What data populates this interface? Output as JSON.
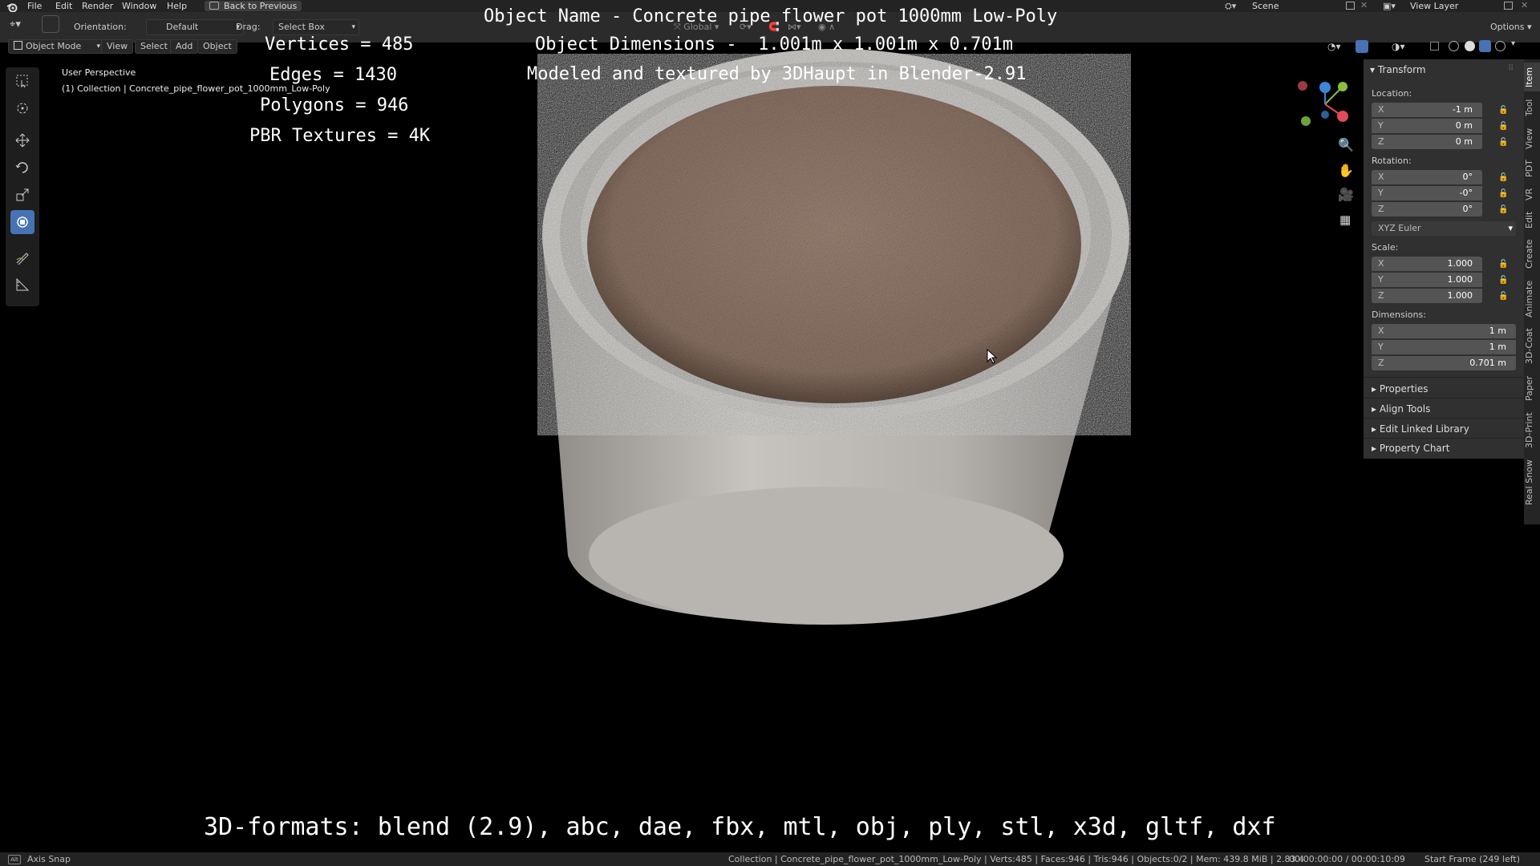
{
  "menubar": {
    "items": [
      "File",
      "Edit",
      "Render",
      "Window",
      "Help"
    ],
    "back_button": "Back to Previous",
    "scene_label": "Scene",
    "view_layer_label": "View Layer"
  },
  "toolheader": {
    "orientation_label": "Orientation:",
    "orientation_value": "Default",
    "drag_label": "Drag:",
    "drag_value": "Select Box",
    "transform_orientation": "Global",
    "options_label": "Options"
  },
  "viewport_header": {
    "mode": "Object Mode",
    "menus": [
      "View",
      "Select",
      "Add",
      "Object"
    ]
  },
  "viewport": {
    "perspective_label": "User Perspective",
    "collection_label": "(1) Collection | Concrete_pipe_flower_pot_1000mm_Low-Poly"
  },
  "overlay": {
    "vertices": "Vertices = 485",
    "edges": "Edges = 1430",
    "polygons": "Polygons = 946",
    "textures": "PBR Textures = 4K",
    "object_name": "Object Name - Concrete pipe flower pot 1000mm Low-Poly",
    "object_dimensions": "Object Dimensions -  1.001m x 1.001m x 0.701m",
    "credit": "Modeled and textured by 3DHaupt in Blender-2.91",
    "formats": "3D-formats: blend (2.9), abc, dae, fbx, mtl, obj, ply, stl, x3d, gltf, dxf"
  },
  "npanel": {
    "section_title": "Transform",
    "location_label": "Location:",
    "location": {
      "x": "-1 m",
      "y": "0 m",
      "z": "0 m"
    },
    "rotation_label": "Rotation:",
    "rotation": {
      "x": "0°",
      "y": "-0°",
      "z": "0°"
    },
    "rotation_mode": "XYZ Euler",
    "scale_label": "Scale:",
    "scale": {
      "x": "1.000",
      "y": "1.000",
      "z": "1.000"
    },
    "dimensions_label": "Dimensions:",
    "dimensions": {
      "x": "1 m",
      "y": "1 m",
      "z": "0.701 m"
    },
    "axis": {
      "x": "X",
      "y": "Y",
      "z": "Z"
    },
    "subpanels": [
      "Properties",
      "Align Tools",
      "Edit Linked Library",
      "Property Chart"
    ]
  },
  "sidebar_tabs": [
    "Item",
    "Tool",
    "View",
    "PDT",
    "VR",
    "Edit",
    "Create",
    "Animate",
    "3D-Coat",
    "Paper",
    "3D-Print",
    "Real Snow"
  ],
  "statusbar": {
    "left": "Axis Snap",
    "info": "Collection | Concrete_pipe_flower_pot_1000mm_Low-Poly | Verts:485 | Faces:946 | Tris:946 | Objects:0/2 | Mem: 439.8 MiB | 2.83.4",
    "timecode": "00:00:00:00 / 00:00:10:09",
    "frame": "Start Frame (249 left)"
  },
  "colors": {
    "accent": "#4772b3",
    "panel": "#303030",
    "field": "#545454"
  }
}
